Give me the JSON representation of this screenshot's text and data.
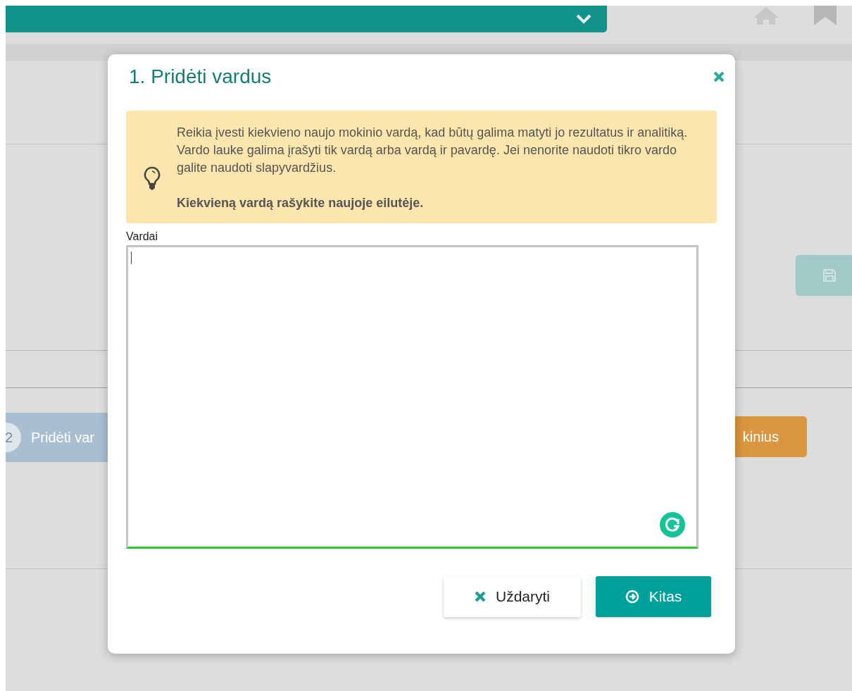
{
  "background_page": {
    "step_button": {
      "number": "2",
      "label": "Pridėti var"
    },
    "orange_button": {
      "label": "kinius"
    }
  },
  "dialog": {
    "title": "1. Pridėti vardus",
    "info": {
      "text": "Reikia įvesti kiekvieno naujo mokinio vardą, kad būtų galima matyti jo rezultatus ir analitiką. Vardo lauke galima įrašyti tik vardą arba vardą ir pavardę. Jei nenorite naudoti tikro vardo galite naudoti slapyvardžius.",
      "emphasis": "Kiekvieną vardą rašykite naujoje eilutėje."
    },
    "field": {
      "label": "Vardai",
      "focused": true
    },
    "buttons": [
      {
        "label": "Uždaryti",
        "kind": "secondary"
      },
      {
        "label": "Kitas",
        "kind": "primary"
      }
    ]
  }
}
